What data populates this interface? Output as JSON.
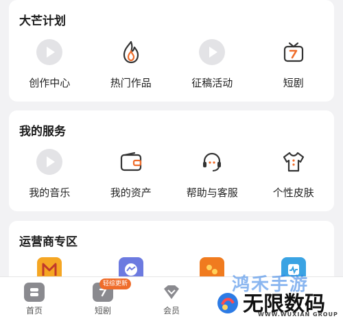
{
  "sections": {
    "plan": {
      "title": "大芒计划",
      "items": [
        {
          "label": "创作中心",
          "icon": "play-circle-icon"
        },
        {
          "label": "热门作品",
          "icon": "flame-icon"
        },
        {
          "label": "征稿活动",
          "icon": "play-circle-icon"
        },
        {
          "label": "短剧",
          "icon": "tv-icon"
        }
      ]
    },
    "services": {
      "title": "我的服务",
      "items": [
        {
          "label": "我的音乐",
          "icon": "play-circle-icon"
        },
        {
          "label": "我的资产",
          "icon": "wallet-icon"
        },
        {
          "label": "帮助与客服",
          "icon": "headset-icon"
        },
        {
          "label": "个性皮肤",
          "icon": "tshirt-icon"
        }
      ]
    },
    "operator": {
      "title": "运营商专区"
    }
  },
  "bottom_nav": {
    "items": [
      {
        "label": "首页",
        "icon": "home-icon"
      },
      {
        "label": "短剧",
        "icon": "short-drama-icon"
      },
      {
        "label": "会员",
        "icon": "vip-diamond-icon"
      }
    ],
    "badge": "轻综更新"
  },
  "watermark": {
    "line1": "鸿禾手游",
    "line2": "无限数码",
    "line3": "WWW.WUXIAN GROUP"
  },
  "colors": {
    "accent": "#ef6c2a",
    "icon_gray": "#8a8a8f",
    "card_bg": "#ffffff",
    "page_bg": "#f2f2f4"
  }
}
